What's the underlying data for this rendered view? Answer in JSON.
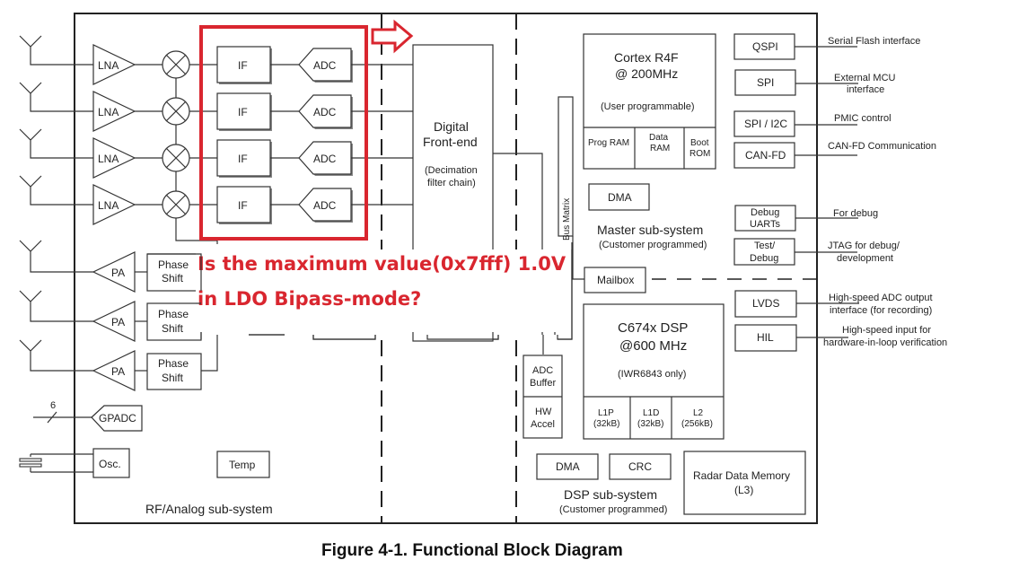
{
  "caption": "Figure 4-1. Functional Block Diagram",
  "annotation": {
    "line1": "Is the maximum value(0x7fff) 1.0V",
    "line2": "in LDO Bipass-mode?",
    "color": "#d9262f"
  },
  "rf": {
    "title": "RF/Analog sub-system",
    "rx_chains": [
      {
        "lna": "LNA",
        "if": "IF",
        "adc": "ADC"
      },
      {
        "lna": "LNA",
        "if": "IF",
        "adc": "ADC"
      },
      {
        "lna": "LNA",
        "if": "IF",
        "adc": "ADC"
      },
      {
        "lna": "LNA",
        "if": "IF",
        "adc": "ADC"
      }
    ],
    "tx_chains": [
      {
        "pa": "PA",
        "phase1": "Phase",
        "phase2": "Shift"
      },
      {
        "pa": "PA",
        "phase1": "Phase",
        "phase2": "Shift"
      },
      {
        "pa": "PA",
        "phase1": "Phase",
        "phase2": "Shift"
      }
    ],
    "gpadc": "GPADC",
    "gpadc_bus_width": "6",
    "osc": "Osc.",
    "temp": "Temp"
  },
  "dfe": {
    "line1": "Digital",
    "line2": "Front-end",
    "sub1": "(Decimation",
    "sub2": "filter chain)"
  },
  "bus_matrix": "Bus Matrix",
  "master": {
    "cpu1": "Cortex R4F",
    "cpu2": "@ 200MHz",
    "cpu_sub": "(User programmable)",
    "prog_ram": "Prog RAM",
    "data_ram1": "Data",
    "data_ram2": "RAM",
    "boot_rom1": "Boot",
    "boot_rom2": "ROM",
    "dma": "DMA",
    "title": "Master sub-system",
    "subtitle": "(Customer programmed)"
  },
  "mailbox": "Mailbox",
  "dsp": {
    "core1": "C674x DSP",
    "core2": "@600 MHz",
    "core_sub": "(IWR6843 only)",
    "l1p1": "L1P",
    "l1p2": "(32kB)",
    "l1d1": "L1D",
    "l1d2": "(32kB)",
    "l21": "L2",
    "l22": "(256kB)",
    "adc_buffer1": "ADC",
    "adc_buffer2": "Buffer",
    "hw_accel1": "HW",
    "hw_accel2": "Accel",
    "dma": "DMA",
    "crc": "CRC",
    "radar_mem1": "Radar Data Memory",
    "radar_mem2": "(L3)",
    "title": "DSP sub-system",
    "subtitle": "(Customer programmed)"
  },
  "peripherals": [
    {
      "name": "QSPI",
      "desc": [
        "Serial Flash interface"
      ]
    },
    {
      "name": "SPI",
      "desc": [
        "External MCU",
        "interface"
      ]
    },
    {
      "name": "SPI / I2C",
      "desc": [
        "PMIC control"
      ]
    },
    {
      "name": "CAN-FD",
      "desc": [
        "CAN-FD Communication"
      ]
    },
    {
      "name": "Debug UARTs",
      "name1": "Debug",
      "name2": "UARTs",
      "desc": [
        "For debug"
      ]
    },
    {
      "name": "Test/ Debug",
      "name1": "Test/",
      "name2": "Debug",
      "desc": [
        "JTAG for debug/",
        "development"
      ]
    },
    {
      "name": "LVDS",
      "desc": [
        "High-speed ADC output",
        "interface (for recording)"
      ]
    },
    {
      "name": "HIL",
      "desc": [
        "High-speed input for",
        "hardware-in-loop verification"
      ]
    }
  ]
}
